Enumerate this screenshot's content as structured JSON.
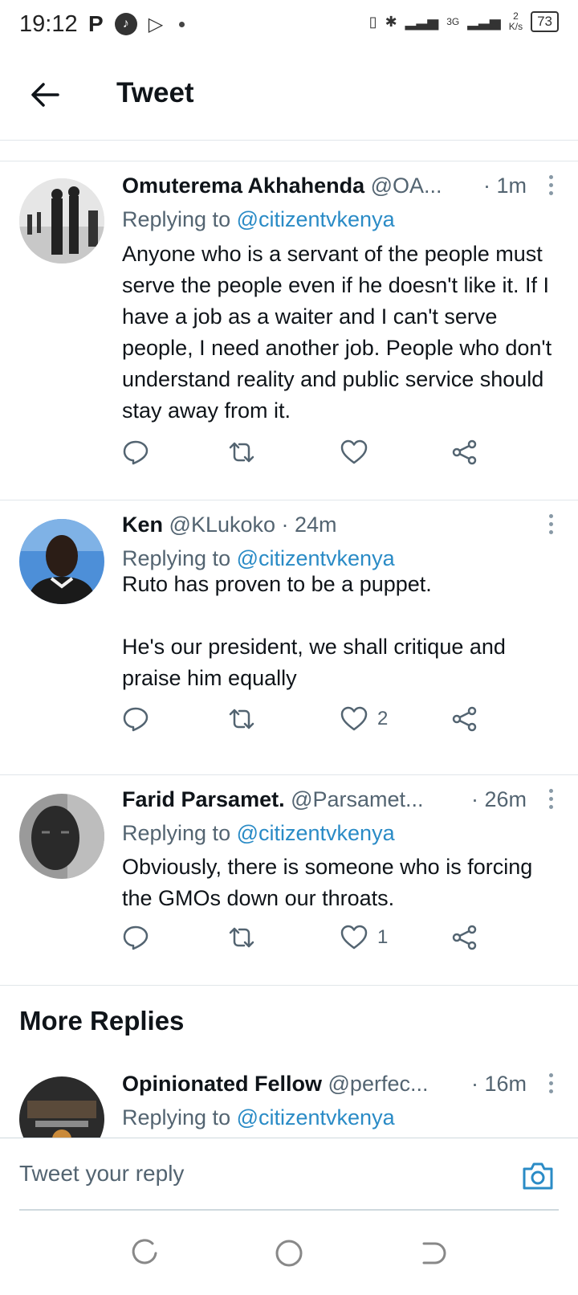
{
  "status_bar": {
    "time": "19:12",
    "network": "3G",
    "speed_value": "2",
    "speed_unit": "K/s",
    "battery": "73"
  },
  "header": {
    "title": "Tweet"
  },
  "tweets": [
    {
      "name": "Omuterema Akhahenda",
      "handle": "@OA...",
      "time": "· 1m",
      "replying_prefix": "Replying to ",
      "replying_to": "@citizentvkenya",
      "text": "Anyone who is a servant of the people must serve the people even if he doesn't like it. If I have a job as a waiter and I can't serve people, I need another job. People who don't understand reality and public service should stay away from it.",
      "likes": ""
    },
    {
      "name": "Ken",
      "handle": "@KLukoko",
      "time": "· 24m",
      "replying_prefix": "Replying to ",
      "replying_to": "@citizentvkenya",
      "text": "Ruto has proven to be a puppet.\n\nHe's our president, we shall critique and praise him equally",
      "likes": "2"
    },
    {
      "name": "Farid Parsamet.",
      "handle": "@Parsamet...",
      "time": "· 26m",
      "replying_prefix": "Replying to ",
      "replying_to": "@citizentvkenya",
      "text": "Obviously, there is someone who is forcing the GMOs down our throats.",
      "likes": "1"
    },
    {
      "name": "Opinionated Fellow",
      "handle": "@perfec...",
      "time": "· 16m",
      "replying_prefix": "Replying to ",
      "replying_to": "@citizentvkenya",
      "text": "",
      "likes": ""
    }
  ],
  "more_replies_title": "More Replies",
  "reply_bar": {
    "placeholder": "Tweet your reply"
  },
  "colors": {
    "link": "#2a8bc6",
    "secondary_text": "#536471",
    "divider": "#e1e6ea"
  }
}
